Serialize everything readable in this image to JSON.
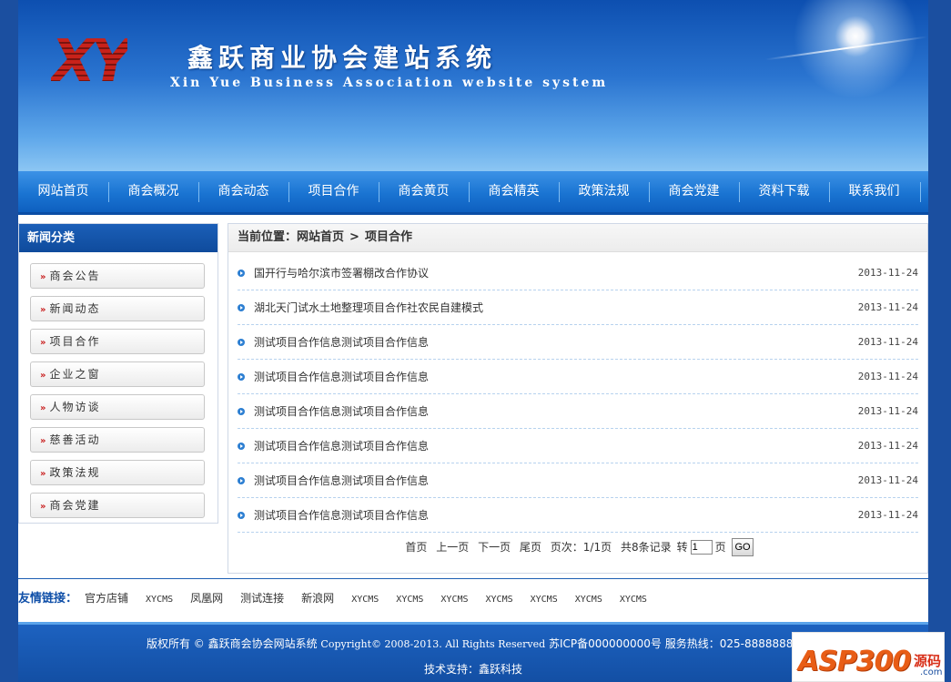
{
  "header": {
    "logo_text": "XY",
    "title": "鑫跃商业协会建站系统",
    "subtitle": "Xin Yue Business Association website system"
  },
  "nav": [
    "网站首页",
    "商会概况",
    "商会动态",
    "项目合作",
    "商会黄页",
    "商会精英",
    "政策法规",
    "商会党建",
    "资料下载",
    "联系我们"
  ],
  "sidebar": {
    "title": "新闻分类",
    "items": [
      "商会公告",
      "新闻动态",
      "项目合作",
      "企业之窗",
      "人物访谈",
      "慈善活动",
      "政策法规",
      "商会党建"
    ]
  },
  "breadcrumb": {
    "prefix": "当前位置：",
    "home": "网站首页",
    "sep": ">",
    "current": "项目合作"
  },
  "news": [
    {
      "title": "国开行与哈尔滨市签署棚改合作协议",
      "date": "2013-11-24"
    },
    {
      "title": "湖北天门试水土地整理项目合作社农民自建模式",
      "date": "2013-11-24"
    },
    {
      "title": "测试项目合作信息测试项目合作信息",
      "date": "2013-11-24"
    },
    {
      "title": "测试项目合作信息测试项目合作信息",
      "date": "2013-11-24"
    },
    {
      "title": "测试项目合作信息测试项目合作信息",
      "date": "2013-11-24"
    },
    {
      "title": "测试项目合作信息测试项目合作信息",
      "date": "2013-11-24"
    },
    {
      "title": "测试项目合作信息测试项目合作信息",
      "date": "2013-11-24"
    },
    {
      "title": "测试项目合作信息测试项目合作信息",
      "date": "2013-11-24"
    }
  ],
  "pager": {
    "first": "首页",
    "prev": "上一页",
    "next": "下一页",
    "last": "尾页",
    "page_info": "页次：1/1页",
    "total": "共8条记录",
    "goto_label": "转",
    "goto_value": "1",
    "page_unit": "页",
    "go_button": "GO"
  },
  "links": {
    "label": "友情链接：",
    "items": [
      "官方店铺",
      "XYCMS",
      "凤凰网",
      "测试连接",
      "新浪网",
      "XYCMS",
      "XYCMS",
      "XYCMS",
      "XYCMS",
      "XYCMS",
      "XYCMS",
      "XYCMS"
    ]
  },
  "footer": {
    "copyright_prefix": "版权所有 © 鑫跃商会协会网站系统",
    "copyright_en": "Copyright© 2008-2013. All Rights Reserved",
    "icp": "苏ICP备000000000号",
    "hotline": "服务热线：025-88888888",
    "support": "技术支持：鑫跃科技"
  },
  "watermark": {
    "brand": "ASP300",
    "tag": "源码",
    "domain": ".com"
  }
}
